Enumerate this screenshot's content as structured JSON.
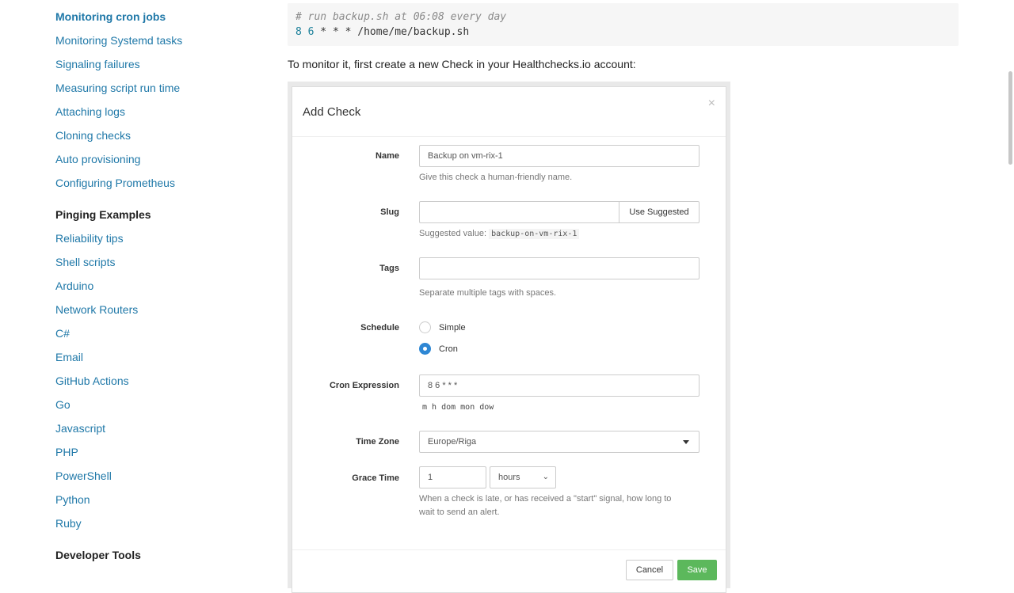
{
  "sidebar": {
    "links_top": [
      {
        "label": "Monitoring cron jobs",
        "active": true
      },
      {
        "label": "Monitoring Systemd tasks"
      },
      {
        "label": "Signaling failures"
      },
      {
        "label": "Measuring script run time"
      },
      {
        "label": "Attaching logs"
      },
      {
        "label": "Cloning checks"
      },
      {
        "label": "Auto provisioning"
      },
      {
        "label": "Configuring Prometheus"
      }
    ],
    "heading_pinging": "Pinging Examples",
    "links_pinging": [
      {
        "label": "Reliability tips"
      },
      {
        "label": "Shell scripts"
      },
      {
        "label": "Arduino"
      },
      {
        "label": "Network Routers"
      },
      {
        "label": "C#"
      },
      {
        "label": "Email"
      },
      {
        "label": "GitHub Actions"
      },
      {
        "label": "Go"
      },
      {
        "label": "Javascript"
      },
      {
        "label": "PHP"
      },
      {
        "label": "PowerShell"
      },
      {
        "label": "Python"
      },
      {
        "label": "Ruby"
      }
    ],
    "heading_devtools": "Developer Tools"
  },
  "content": {
    "code_comment": "# run backup.sh at 06:08 every day",
    "code_nums": "8 6",
    "code_rest": " * * * /home/me/backup.sh",
    "intro": "To monitor it, first create a new Check in your Healthchecks.io account:"
  },
  "modal": {
    "title": "Add Check",
    "close_glyph": "×",
    "name_label": "Name",
    "name_value": "Backup on vm-rix-1",
    "name_help": "Give this check a human-friendly name.",
    "slug_label": "Slug",
    "slug_value": "",
    "use_suggested": "Use Suggested",
    "slug_help_prefix": "Suggested value:",
    "slug_suggested": "backup-on-vm-rix-1",
    "tags_label": "Tags",
    "tags_value": "",
    "tags_help": "Separate multiple tags with spaces.",
    "schedule_label": "Schedule",
    "schedule_simple": "Simple",
    "schedule_cron": "Cron",
    "cron_label": "Cron Expression",
    "cron_value": "8 6 * * *",
    "cron_help": "m h dom mon dow",
    "tz_label": "Time Zone",
    "tz_value": "Europe/Riga",
    "grace_label": "Grace Time",
    "grace_value": "1",
    "grace_unit": "hours",
    "grace_help_1": "When a check is late, or has received a \"start\" signal, how long to",
    "grace_help_2": "wait to send an alert.",
    "cancel": "Cancel",
    "save": "Save"
  }
}
